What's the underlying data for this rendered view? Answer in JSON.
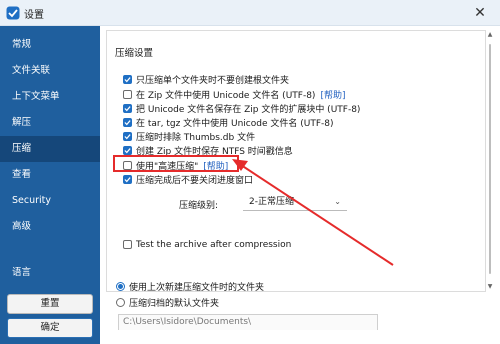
{
  "window": {
    "title": "设置",
    "close_glyph": "✕"
  },
  "sidebar": {
    "items": [
      {
        "label": "常规"
      },
      {
        "label": "文件关联"
      },
      {
        "label": "上下文菜单"
      },
      {
        "label": "解压"
      },
      {
        "label": "压缩",
        "active": true
      },
      {
        "label": "查看"
      },
      {
        "label": "Security"
      },
      {
        "label": "高级"
      },
      {
        "label": "语言"
      }
    ],
    "reset_label": "重置",
    "ok_label": "确定"
  },
  "main": {
    "section_title": "压缩设置",
    "options": [
      {
        "label": "只压缩单个文件夹时不要创建根文件夹",
        "checked": true
      },
      {
        "label": "在 Zip 文件中使用 Unicode 文件名 (UTF-8)",
        "checked": false,
        "link": "[帮助]"
      },
      {
        "label": "把 Unicode 文件名保存在 Zip 文件的扩展块中 (UTF-8)",
        "checked": true
      },
      {
        "label": "在 tar, tgz 文件中使用 Unicode 文件名 (UTF-8)",
        "checked": true
      },
      {
        "label": "压缩时排除 Thumbs.db 文件",
        "checked": true
      },
      {
        "label": "创建 Zip 文件时保存 NTFS 时间戳信息",
        "checked": true
      },
      {
        "label": "使用\"高速压缩\"",
        "checked": false,
        "link": "[帮助]"
      },
      {
        "label": "压缩完成后不要关闭进度窗口",
        "checked": true
      }
    ],
    "level_label": "压缩级别:",
    "level_value": "2-正常压缩",
    "test_archive": {
      "label": "Test the archive after compression",
      "checked": false
    },
    "radios": [
      {
        "label": "使用上次新建压缩文件时的文件夹",
        "checked": true
      },
      {
        "label": "压缩归档的默认文件夹",
        "checked": false
      }
    ],
    "default_path": "C:\\Users\\Isidore\\Documents\\"
  },
  "colors": {
    "sidebar": "#1f5f9e",
    "sidebar_active": "#15477a",
    "accent": "#1f6fc4",
    "annotation": "#e52b2b"
  }
}
